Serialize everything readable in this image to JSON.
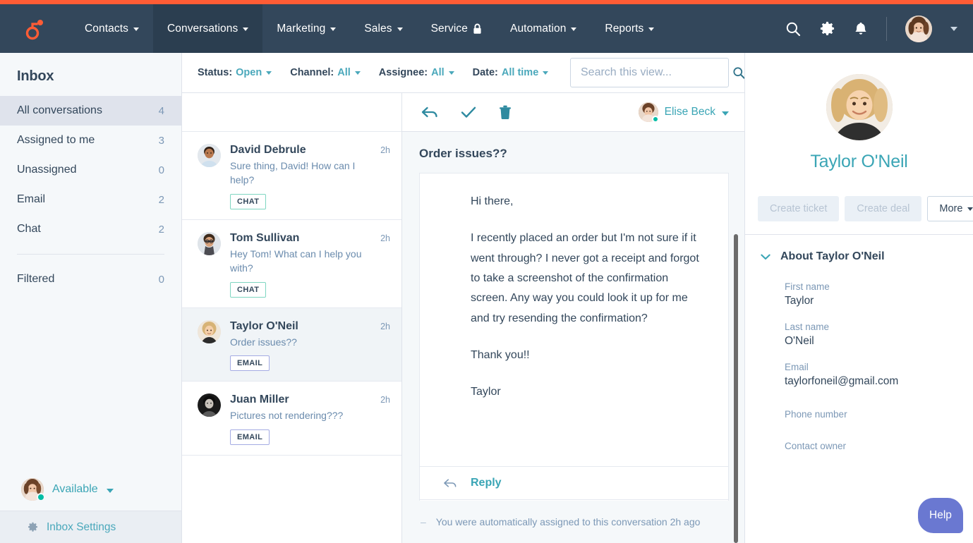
{
  "theme": {
    "accent_orange": "#ff5c35",
    "nav_bg": "#33475b",
    "teal": "#3aa5b5",
    "chat_badge_border": "#7fd6c1",
    "email_badge_border": "#a4abe3",
    "help_purple": "#6a78d1",
    "online_green": "#00bda5"
  },
  "nav": {
    "logo": "hubspot-sprocket-logo",
    "items": [
      {
        "label": "Contacts",
        "has_caret": true,
        "active": false
      },
      {
        "label": "Conversations",
        "has_caret": true,
        "active": true
      },
      {
        "label": "Marketing",
        "has_caret": true,
        "active": false
      },
      {
        "label": "Sales",
        "has_caret": true,
        "active": false
      },
      {
        "label": "Service",
        "has_caret": false,
        "active": false,
        "icon": "lock-icon"
      },
      {
        "label": "Automation",
        "has_caret": true,
        "active": false
      },
      {
        "label": "Reports",
        "has_caret": true,
        "active": false
      }
    ],
    "right_icons": [
      "search-icon",
      "gear-icon",
      "bell-icon"
    ],
    "avatar": "user-avatar"
  },
  "sidebar": {
    "title": "Inbox",
    "items": [
      {
        "label": "All conversations",
        "count": "4",
        "selected": true
      },
      {
        "label": "Assigned to me",
        "count": "3",
        "selected": false
      },
      {
        "label": "Unassigned",
        "count": "0",
        "selected": false
      },
      {
        "label": "Email",
        "count": "2",
        "selected": false
      },
      {
        "label": "Chat",
        "count": "2",
        "selected": false
      }
    ],
    "filtered": {
      "label": "Filtered",
      "count": "0"
    },
    "status": {
      "label": "Available",
      "state": "online"
    },
    "settings": {
      "label": "Inbox Settings",
      "icon": "gear-icon"
    }
  },
  "filterbar": {
    "filters": [
      {
        "label": "Status:",
        "value": "Open"
      },
      {
        "label": "Channel:",
        "value": "All"
      },
      {
        "label": "Assignee:",
        "value": "All"
      },
      {
        "label": "Date:",
        "value": "All time"
      }
    ],
    "search": {
      "placeholder": "Search this view...",
      "value": "",
      "icon": "search-icon"
    }
  },
  "conversations": [
    {
      "name": "David Debrule",
      "time": "2h",
      "preview": "Sure thing, David! How can I help?",
      "channel": "CHAT",
      "channel_type": "chat",
      "selected": false
    },
    {
      "name": "Tom Sullivan",
      "time": "2h",
      "preview": "Hey Tom! What can I help you with?",
      "channel": "CHAT",
      "channel_type": "chat",
      "selected": false
    },
    {
      "name": "Taylor O'Neil",
      "time": "2h",
      "preview": "Order issues??",
      "channel": "EMAIL",
      "channel_type": "email",
      "selected": true
    },
    {
      "name": "Juan Miller",
      "time": "2h",
      "preview": "Pictures not rendering???",
      "channel": "EMAIL",
      "channel_type": "email",
      "selected": false
    }
  ],
  "thread": {
    "toolbar": {
      "icons": [
        "reply-icon",
        "check-icon",
        "trash-icon"
      ],
      "assignee_name": "Elise Beck"
    },
    "subject": "Order issues??",
    "paragraphs": [
      "Hi there,",
      "I recently placed an order but I'm not sure if it went through? I never got a receipt and forgot to take a screenshot of the confirmation screen. Any way you could look it up for me and try resending the confirmation?",
      "Thank you!!",
      "Taylor"
    ],
    "reply_label": "Reply",
    "system_note": "You were automatically assigned to this conversation 2h ago"
  },
  "contact": {
    "name": "Taylor O'Neil",
    "buttons": {
      "create_ticket": "Create ticket",
      "create_deal": "Create deal",
      "more": "More"
    },
    "about_title": "About Taylor O'Neil",
    "fields": [
      {
        "label": "First name",
        "value": "Taylor"
      },
      {
        "label": "Last name",
        "value": "O'Neil"
      },
      {
        "label": "Email",
        "value": "taylorfoneil@gmail.com"
      },
      {
        "label": "Phone number",
        "value": ""
      },
      {
        "label": "Contact owner",
        "value": ""
      }
    ]
  },
  "help": {
    "label": "Help"
  }
}
